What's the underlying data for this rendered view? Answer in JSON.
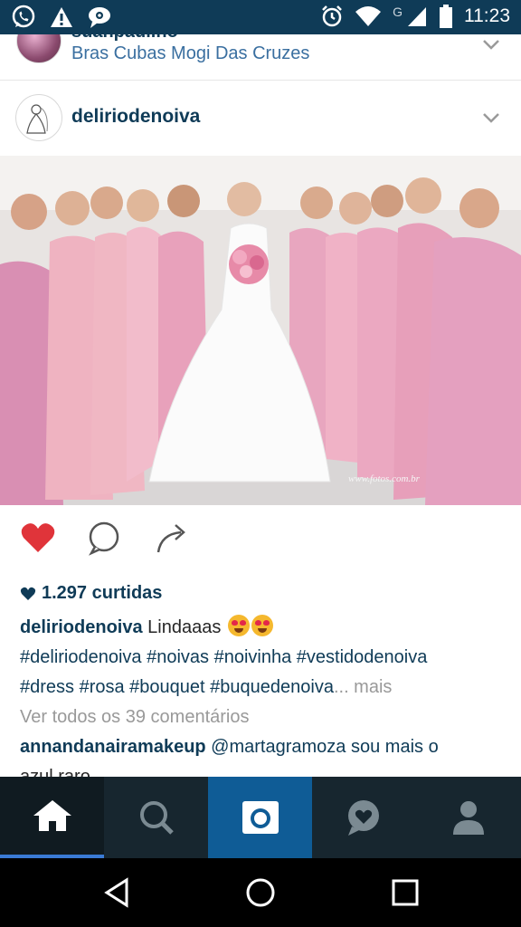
{
  "status_bar": {
    "time": "11:23",
    "network_label": "G",
    "left_icons": [
      "whatsapp-icon",
      "alert-icon",
      "chat-icon"
    ],
    "right_icons": [
      "alarm-icon",
      "wifi-icon",
      "signal-icon",
      "battery-icon"
    ]
  },
  "previous_post": {
    "username": "suanpaulino",
    "location": "Bras Cubas Mogi Das Cruzes"
  },
  "post": {
    "username": "deliriodenoiva",
    "photo_watermark": "www.fotos.com.br",
    "likes_text": "1.297 curtidas",
    "caption_user": "deliriodenoiva",
    "caption_text": " Lindaaas ",
    "hashtags_line1": "#deliriodenoiva #noivas #noivinha #vestidodenoiva",
    "hashtags_line2": "#dress #rosa #bouquet #buquedenoiva",
    "more_label": "... mais",
    "view_all_comments": "Ver todos os 39 comentários",
    "comment_user": "annandanairamakeup",
    "comment_text": " @martagramoza sou mais o",
    "comment_text_cont": "azul raro",
    "liked": true
  },
  "colors": {
    "status_bar": "#0f3b57",
    "accent_text": "#0f3b57",
    "heart": "#e0343a",
    "tab_bar": "#17262f",
    "camera_tab": "#0f5c96"
  },
  "tabs": [
    {
      "name": "home",
      "icon": "home-icon",
      "active": true
    },
    {
      "name": "search",
      "icon": "search-icon"
    },
    {
      "name": "camera",
      "icon": "camera-icon"
    },
    {
      "name": "activity",
      "icon": "activity-heart-icon"
    },
    {
      "name": "profile",
      "icon": "profile-icon"
    }
  ],
  "nav_buttons": [
    "back-icon",
    "home-circle-icon",
    "recents-icon"
  ]
}
